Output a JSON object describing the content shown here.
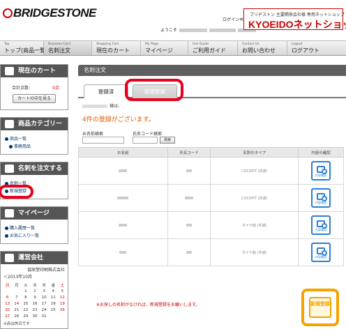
{
  "header": {
    "logo": "BRIDGESTONE",
    "login_link": "ログインヰ",
    "greeting_prefix": "ようこそ",
    "shop_subtitle": "ブリヂストン 主要関係会社様 専用ネットショップ",
    "shop_title": "KYOEIDOネットショップ"
  },
  "nav": [
    {
      "en": "Top",
      "jp": "トップ(商品一覧)"
    },
    {
      "en": "Business Card",
      "jp": "名刺注文"
    },
    {
      "en": "Shopping Cart",
      "jp": "現在のカート"
    },
    {
      "en": "My Page",
      "jp": "マイページ"
    },
    {
      "en": "Use Guide",
      "jp": "ご利用ガイド"
    },
    {
      "en": "Contact Us",
      "jp": "お問い合わせ"
    },
    {
      "en": "Logout",
      "jp": "ログアウト"
    }
  ],
  "sidebar": {
    "cart": {
      "title": "現在のカート",
      "total_label": "合計点数:",
      "total_value": "0点",
      "view_button": "カートの中を見る"
    },
    "category": {
      "title": "商品カテゴリー",
      "items": [
        "商品一覧",
        "事務用品"
      ]
    },
    "order": {
      "title": "名刺を注文する",
      "items": [
        "名刺一覧",
        "新規登録"
      ]
    },
    "mypage": {
      "title": "マイページ",
      "items": [
        "購入履歴一覧",
        "お気に入り一覧"
      ]
    },
    "company": {
      "title": "運営会社",
      "name": "協栄堂印刷株式会社",
      "month": "＜2013年10月",
      "weekdays": [
        "日",
        "月",
        "火",
        "水",
        "木",
        "金",
        "土"
      ],
      "weeks": [
        [
          "",
          "",
          "1",
          "2",
          "3",
          "4",
          "5"
        ],
        [
          "6",
          "7",
          "8",
          "9",
          "10",
          "11",
          "12"
        ],
        [
          "13",
          "14",
          "15",
          "16",
          "17",
          "18",
          "19"
        ],
        [
          "20",
          "21",
          "22",
          "23",
          "24",
          "25",
          "26"
        ],
        [
          "27",
          "28",
          "29",
          "30",
          "31",
          "",
          ""
        ]
      ],
      "note": "※赤は休日です"
    }
  },
  "main": {
    "title": "名刺注文",
    "tabs": [
      "登録済",
      "新規登録"
    ],
    "honorific": "様は、",
    "count_message": "4件の登録がございます。",
    "search_name_label": "お名前検索",
    "search_code_label": "氏名コード検索",
    "search_button": "検索",
    "columns": [
      "お名前",
      "氏名コード",
      "名刺のタイプ",
      "内容の確認"
    ],
    "rows": [
      {
        "type": "COCKPIT (共通)"
      },
      {
        "type": "COCKPIT (共通)"
      },
      {
        "type": "タイヤ館 (共通)"
      },
      {
        "type": "タイヤ館 (共通)"
      }
    ],
    "confirm_label": "内容確認",
    "notice": "※お探しの名刺がなければ、新規登録をお願いします。",
    "new_button": "新規登録"
  }
}
